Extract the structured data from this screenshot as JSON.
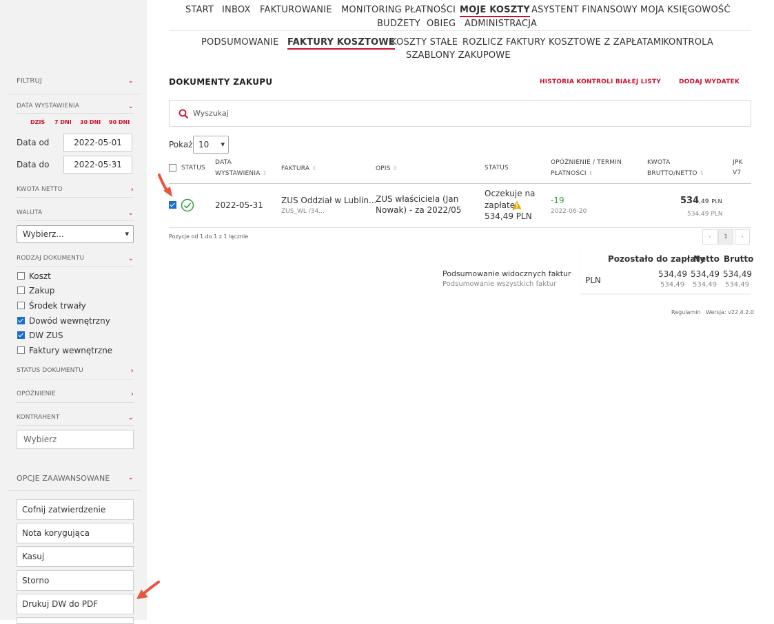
{
  "colors": {
    "accent": "#c8102e",
    "green": "#2e9e3a",
    "warning": "#f0a500",
    "checkbox": "#1a6fce"
  },
  "nav": {
    "main": [
      "START",
      "INBOX",
      "FAKTUROWANIE",
      "MONITORING PŁATNOŚCI",
      "MOJE KOSZTY",
      "ASYSTENT FINANSOWY",
      "MOJA KSIĘGOWOŚĆ",
      "BUDŻETY",
      "OBIEG",
      "ADMINISTRACJA"
    ],
    "main_active": "MOJE KOSZTY",
    "sub": [
      "PODSUMOWANIE",
      "FAKTURY KOSZTOWE",
      "KOSZTY STAŁE",
      "ROZLICZ FAKTURY KOSZTOWE Z ZAPŁATAMI",
      "KONTROLA",
      "SZABLONY ZAKUPOWE"
    ],
    "sub_active": "FAKTURY KOSZTOWE"
  },
  "sidebar": {
    "filter_title": "FILTRUJ",
    "date_section": "DATA WYSTAWIENIA",
    "quick_ranges": [
      "DZIŚ",
      "7 DNI",
      "30 DNI",
      "90 DNI"
    ],
    "date_from_label": "Data od",
    "date_from": "2022-05-01",
    "date_to_label": "Data do",
    "date_to": "2022-05-31",
    "kwota_netto": "KWOTA NETTO",
    "waluta": "WALUTA",
    "waluta_value": "Wybierz...",
    "rodzaj": "RODZAJ DOKUMENTU",
    "doc_types": [
      {
        "label": "Koszt",
        "checked": false
      },
      {
        "label": "Zakup",
        "checked": false
      },
      {
        "label": "Środek trwały",
        "checked": false
      },
      {
        "label": "Dowód wewnętrzny",
        "checked": true
      },
      {
        "label": "DW ZUS",
        "checked": true
      },
      {
        "label": "Faktury wewnętrzne",
        "checked": false
      }
    ],
    "status_dok": "STATUS DOKUMENTU",
    "opoznienie": "OPÓŹNIENIE",
    "kontrahent": "KONTRAHENT",
    "kontrahent_placeholder": "Wybierz",
    "advanced": "OPCJE ZAAWANSOWANE",
    "actions": [
      "Cofnij zatwierdzenie",
      "Nota korygująca",
      "Kasuj",
      "Storno",
      "Drukuj DW do PDF"
    ]
  },
  "main": {
    "title": "DOKUMENTY ZAKUPU",
    "history_link": "HISTORIA KONTROLI BIAŁEJ LISTY",
    "add_link": "DODAJ WYDATEK",
    "search_placeholder": "Wyszukaj",
    "show_label": "Pokaż",
    "show_value": "10",
    "columns": {
      "status": "STATUS",
      "date1": "DATA",
      "date2": "WYSTAWIENIA",
      "faktura": "FAKTURA",
      "opis": "OPIS",
      "status2": "STATUS",
      "delay1": "OPÓŹNIENIE / TERMIN",
      "delay2": "PŁATNOŚCI",
      "amount1": "KWOTA",
      "amount2": "BRUTTO/NETTO",
      "jpk1": "JPK",
      "jpk2": "V7"
    },
    "row": {
      "date": "2022-05-31",
      "faktura": "ZUS Oddział w Lublin...",
      "faktura_sub": "ZUS_WL /34...",
      "opis_1": "ZUS właściciela (Jan",
      "opis_2": "Nowak) - za 2022/05",
      "status_1": "Oczekuje na",
      "status_2": "zapłatę",
      "status_3": "534,49 PLN",
      "delay": "-19",
      "due": "2022-06-20",
      "amount_int": "534",
      "amount_dec": ",49",
      "currency": "PLN",
      "amount_net": "534,49 PLN"
    },
    "pagination_info": "Pozycje od 1 do 1 z 1 łącznie",
    "pagination": [
      "‹",
      "1",
      "›"
    ],
    "summary": {
      "h_remaining": "Pozostało do zapłaty",
      "h_net": "Netto",
      "h_gross": "Brutto",
      "visible_label": "Podsumowanie widocznych faktur",
      "all_label": "Podsumowanie wszystkich faktur",
      "currency": "PLN",
      "visible": [
        "534,49",
        "534,49",
        "534,49"
      ],
      "all": [
        "534,49",
        "534,49",
        "534,49"
      ]
    },
    "footer": {
      "regulamin": "Regulamin",
      "version": "Wersja: v22.4.2.0"
    }
  }
}
